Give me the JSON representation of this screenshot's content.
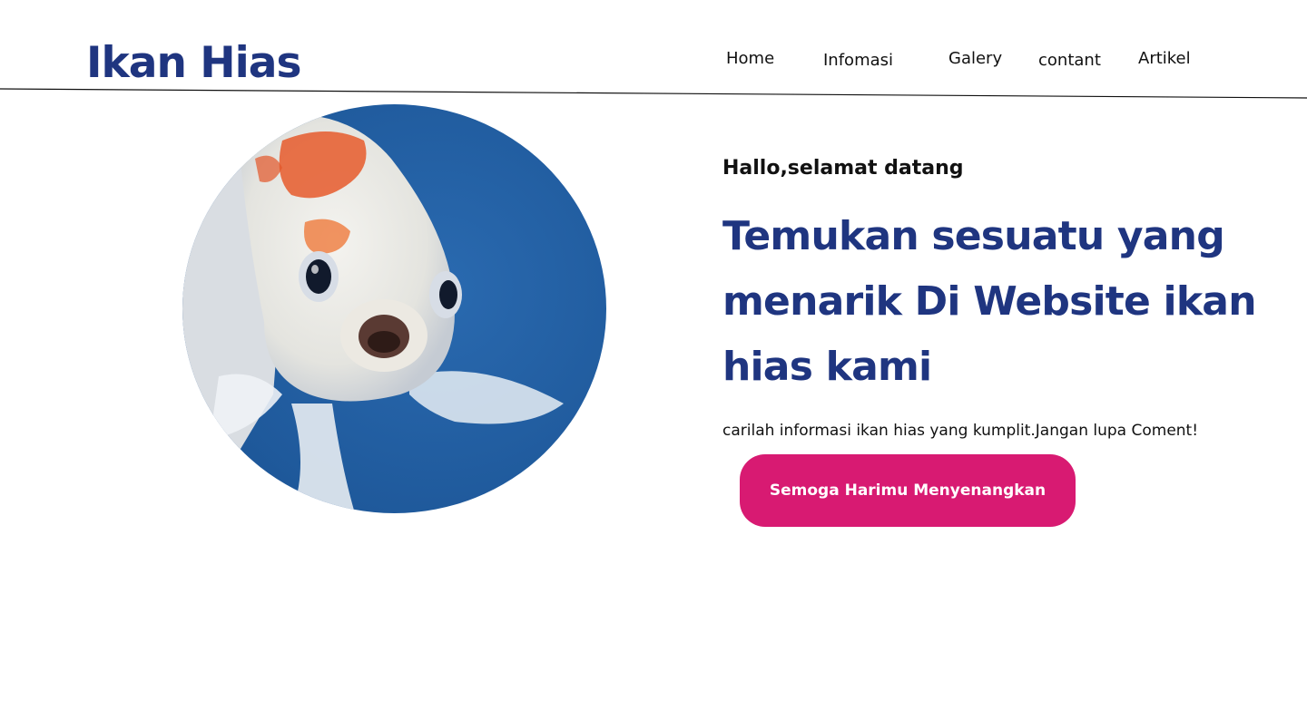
{
  "header": {
    "logo_text": "Ikan Hias",
    "nav": {
      "home": "Home",
      "infomasi": "Infomasi",
      "galery": "Galery",
      "contant": "contant",
      "artikel": "Artikel"
    }
  },
  "hero": {
    "image_icon": "koi-fish-photo",
    "greeting": "Hallo,selamat datang",
    "headline": "Temukan sesuatu yang menarik Di Website ikan hias kami",
    "subtitle": "carilah informasi ikan hias yang kumplit.Jangan lupa Coment!",
    "button_label": "Semoga Harimu Menyenangkan"
  },
  "colors": {
    "brand_navy": "#1f3580",
    "button_pink": "#d81a72",
    "photo_water_blue": "#2260a4",
    "text_dark": "#111111"
  }
}
